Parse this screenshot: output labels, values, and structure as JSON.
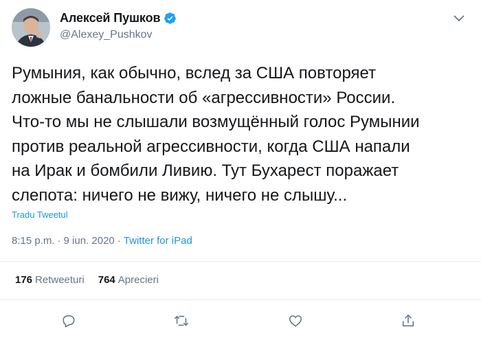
{
  "author": {
    "display_name": "Алексей Пушков",
    "handle": "@Alexey_Pushkov",
    "verified": true
  },
  "tweet": {
    "text": "Румыния, как обычно, вслед за США повторяет\nложные банальности об «агрессивности» России.\nЧто-то мы не слышали возмущённый голос Румынии\nпротив реальной агрессивности, когда США напали\nна Ирак и бомбили Ливию. Тут Бухарест поражает\nслепота: ничего не вижу, ничего не слышу...",
    "translate_label": "Tradu Tweetul",
    "time": "8:15 p.m.",
    "separator": "·",
    "date": "9 iun. 2020",
    "source": "Twitter for iPad"
  },
  "stats": {
    "retweets_count": "176",
    "retweets_label": "Retweeturi",
    "likes_count": "764",
    "likes_label": "Aprecieri"
  },
  "icons": {
    "verified": "verified-badge-icon",
    "caret": "chevron-down-icon",
    "reply": "reply-icon",
    "retweet": "retweet-icon",
    "like": "heart-icon",
    "share": "share-icon"
  },
  "colors": {
    "link": "#1b95e0",
    "secondary_text": "#657786",
    "primary_text": "#14171a",
    "divider": "#e6ecf0",
    "verified": "#1da1f2"
  }
}
